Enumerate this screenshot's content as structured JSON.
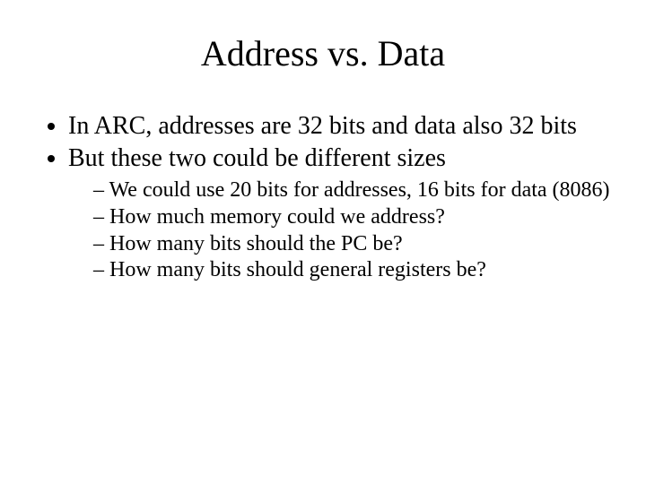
{
  "title": "Address vs. Data",
  "bullets": {
    "b0": "In ARC, addresses are 32 bits and data also 32 bits",
    "b1": "But these two could be different sizes",
    "sub": {
      "s0": "We could use 20 bits for addresses, 16 bits for data (8086)",
      "s1": "How much memory could we address?",
      "s2": "How many bits should the PC be?",
      "s3": "How many bits should general registers be?"
    }
  }
}
